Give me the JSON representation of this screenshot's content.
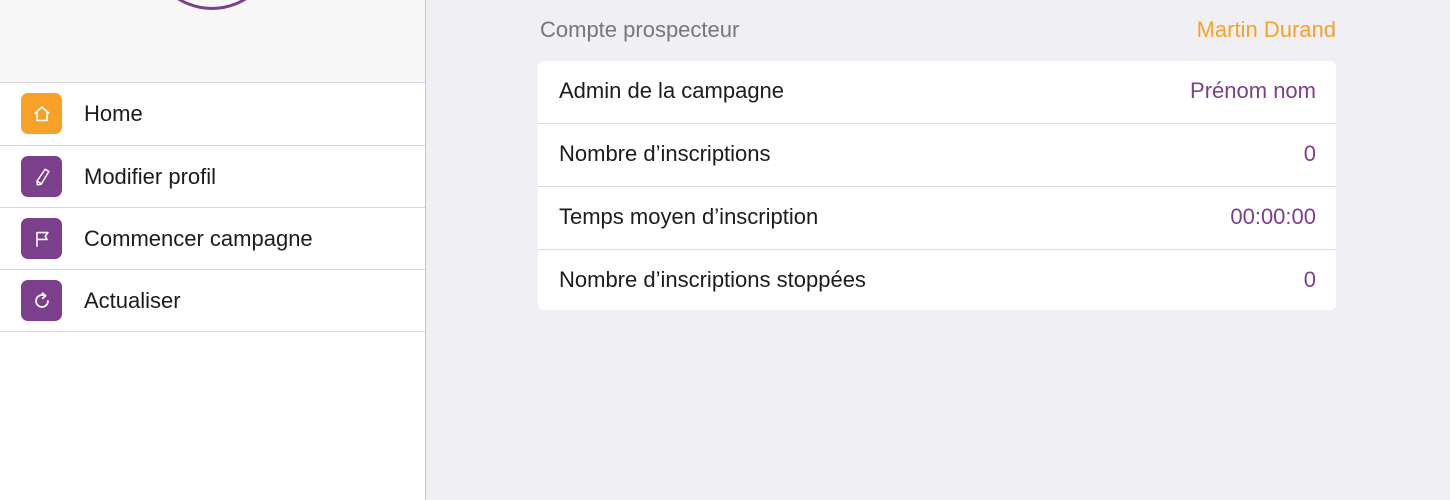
{
  "sidebar": {
    "items": [
      {
        "label": "Home",
        "icon": "home-icon",
        "icon_color": "#f7a128"
      },
      {
        "label": "Modifier profil",
        "icon": "pencil-icon",
        "icon_color": "#7b3f8c"
      },
      {
        "label": "Commencer campagne",
        "icon": "flag-icon",
        "icon_color": "#7b3f8c"
      },
      {
        "label": "Actualiser",
        "icon": "refresh-icon",
        "icon_color": "#7b3f8c"
      }
    ]
  },
  "main": {
    "section_title": "Compte prospecteur",
    "user_name": "Martin Durand",
    "stats": [
      {
        "label": "Admin de la campagne",
        "value": "Prénom nom"
      },
      {
        "label": "Nombre d’inscriptions",
        "value": "0"
      },
      {
        "label": "Temps moyen d’inscription",
        "value": "00:00:00"
      },
      {
        "label": "Nombre d’inscriptions stoppées",
        "value": "0"
      }
    ]
  },
  "colors": {
    "accent_orange": "#f7a128",
    "accent_purple": "#7b3f8c",
    "background": "#efeff4"
  }
}
